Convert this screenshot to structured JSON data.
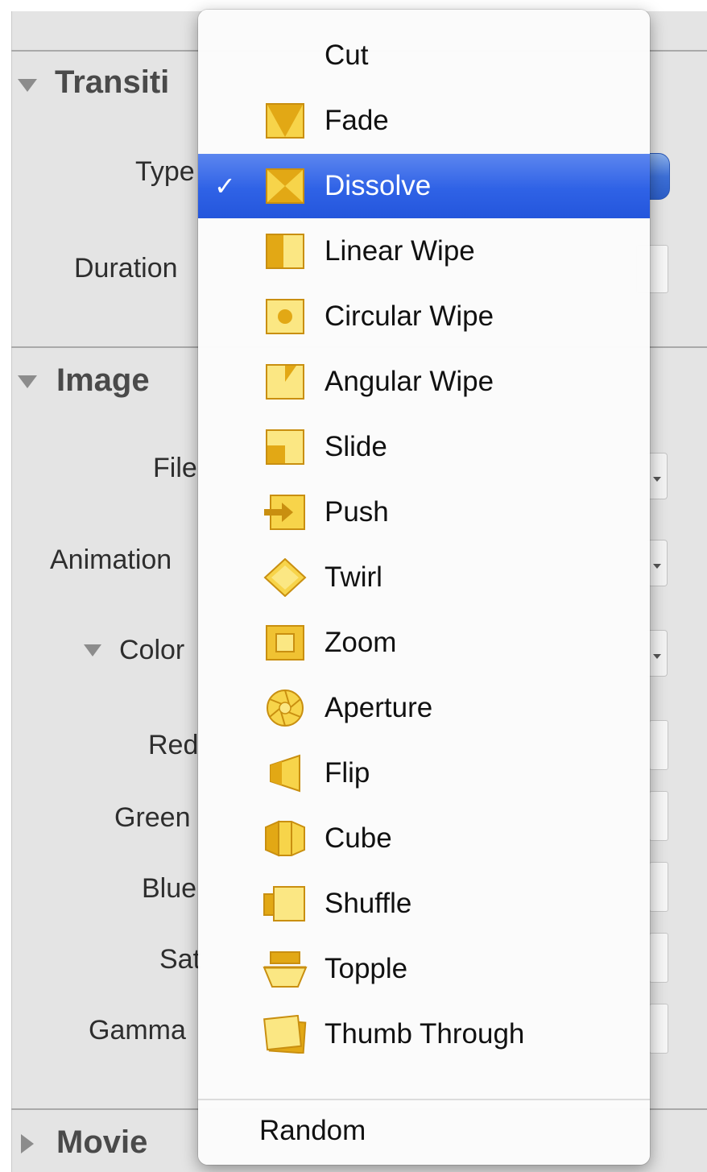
{
  "inspector": {
    "sections": {
      "transition": {
        "title": "Transiti"
      },
      "image": {
        "title": "Image"
      },
      "movie": {
        "title": "Movie"
      }
    },
    "fields": {
      "type": "Type",
      "duration": "Duration",
      "file": "File",
      "animation": "Animation",
      "color": "Color",
      "red": "Red",
      "green": "Green",
      "blue": "Blue",
      "sat": "Sat",
      "gamma": "Gamma"
    }
  },
  "menu": {
    "selected": "Dissolve",
    "checkmark": "✓",
    "items": [
      {
        "label": "Cut",
        "icon": "none"
      },
      {
        "label": "Fade",
        "icon": "fade-icon"
      },
      {
        "label": "Dissolve",
        "icon": "dissolve-icon"
      },
      {
        "label": "Linear Wipe",
        "icon": "linear-wipe-icon"
      },
      {
        "label": "Circular Wipe",
        "icon": "circular-wipe-icon"
      },
      {
        "label": "Angular Wipe",
        "icon": "angular-wipe-icon"
      },
      {
        "label": "Slide",
        "icon": "slide-icon"
      },
      {
        "label": "Push",
        "icon": "push-icon"
      },
      {
        "label": "Twirl",
        "icon": "twirl-icon"
      },
      {
        "label": "Zoom",
        "icon": "zoom-icon"
      },
      {
        "label": "Aperture",
        "icon": "aperture-icon"
      },
      {
        "label": "Flip",
        "icon": "flip-icon"
      },
      {
        "label": "Cube",
        "icon": "cube-icon"
      },
      {
        "label": "Shuffle",
        "icon": "shuffle-icon"
      },
      {
        "label": "Topple",
        "icon": "topple-icon"
      },
      {
        "label": "Thumb Through",
        "icon": "thumb-through-icon"
      }
    ],
    "random": "Random"
  },
  "colors": {
    "selection": "#2f62e6",
    "icon_fill": "#f7d44a",
    "icon_dark": "#e2a815",
    "icon_stroke": "#c98f10"
  }
}
